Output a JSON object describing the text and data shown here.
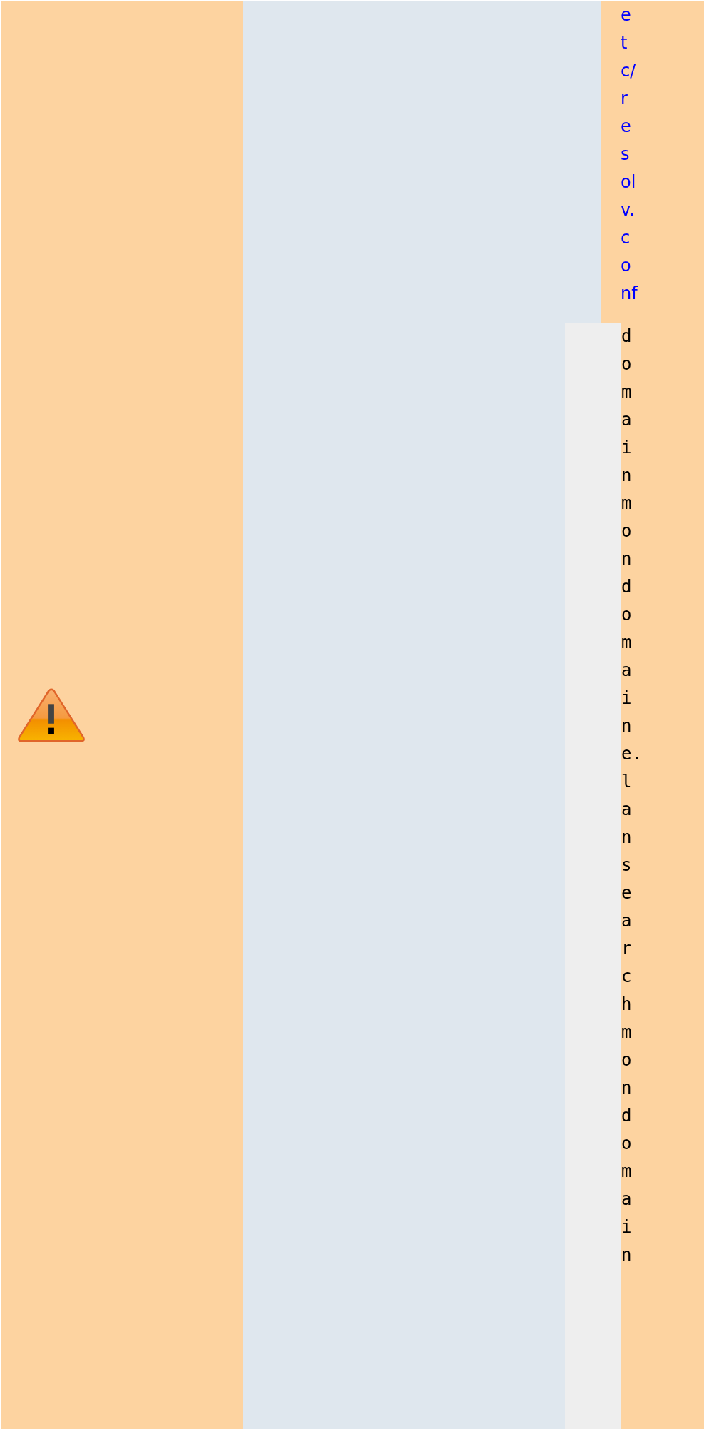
{
  "notice": {
    "file_link": "etc/resolv.conf",
    "code": "domainmondomaine.lansearchmondomain"
  }
}
